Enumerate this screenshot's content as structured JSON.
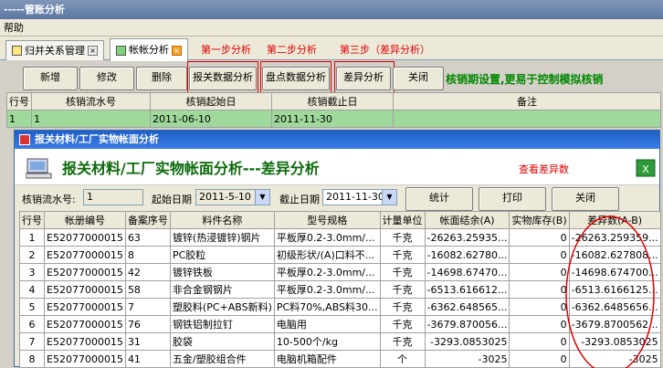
{
  "window": {
    "title": "-----管账分析"
  },
  "menu": {
    "help": "帮助"
  },
  "tabs": [
    {
      "label": "归并关系管理",
      "close": "×"
    },
    {
      "label": "帐帐分析",
      "close": "×"
    }
  ],
  "annotations": {
    "step1": "第一步分析",
    "step2": "第二步分析",
    "step3": "第三步（差异分析）",
    "check_diff": "查看差异数"
  },
  "toolbar": {
    "add": "新增",
    "edit": "修改",
    "delete": "删除",
    "customs_analysis": "报关数据分析",
    "inventory_analysis": "盘点数据分析",
    "diff_analysis": "差异分析",
    "close": "关闭",
    "hint": "核销期设置,更易于控制模拟核销"
  },
  "main_grid": {
    "headers": [
      "行号",
      "核销流水号",
      "核销起始日",
      "核销截止日",
      "备注"
    ],
    "rows": [
      [
        "1",
        "1",
        "2011-06-10",
        "2011-11-30",
        ""
      ]
    ]
  },
  "dialog": {
    "title": "报关材料/工厂实物帐面分析",
    "banner_title": "报关材料/工厂实物帐面分析---差异分析",
    "serial_label": "核销流水号:",
    "serial_value": "1",
    "start_label": "起始日期",
    "start_value": "2011-5-10",
    "end_label": "截止日期",
    "end_value": "2011-11-30",
    "stats_btn": "统计",
    "print_btn": "打印",
    "close_btn": "关闭",
    "grid": {
      "headers": [
        "行号",
        "帐册编号",
        "备案序号",
        "料件名称",
        "型号规格",
        "计量单位",
        "帐面结余(A)",
        "实物库存(B)",
        "差异数(A-B)"
      ],
      "rows": [
        [
          "1",
          "E52077000015",
          "63",
          "镀锌(热浸镀锌)钢片",
          "平板厚0.2-3.0mm/...",
          "千克",
          "-26263.25935...",
          "0",
          "-26263.259359..."
        ],
        [
          "2",
          "E52077000015",
          "8",
          "PC胶粒",
          "初级形状/(A)口料不...",
          "千克",
          "-16082.62780...",
          "0",
          "-16082.627808..."
        ],
        [
          "3",
          "E52077000015",
          "42",
          "镀锌铁板",
          "平板厚0.2-3.0mm/...",
          "千克",
          "-14698.67470...",
          "0",
          "-14698.674700..."
        ],
        [
          "4",
          "E52077000015",
          "58",
          "非合金钢钢片",
          "平板厚0.2-3.0mm/...",
          "千克",
          "-6513.616612...",
          "0",
          "-6513.6166125..."
        ],
        [
          "5",
          "E52077000015",
          "7",
          "塑胶料(PC+ABS新料)",
          "PC料70%,ABS料30...",
          "千克",
          "-6362.648565...",
          "0",
          "-6362.6485656..."
        ],
        [
          "6",
          "E52077000015",
          "76",
          "钢铁铝制拉钉",
          "电脑用",
          "千克",
          "-3679.870056...",
          "0",
          "-3679.8700562..."
        ],
        [
          "7",
          "E52077000015",
          "31",
          "胶袋",
          "10-500个/kg",
          "千克",
          "-3293.0853025",
          "0",
          "-3293.0853025"
        ],
        [
          "8",
          "E52077000015",
          "41",
          "五金/塑胶组合件",
          "电脑机箱配件",
          "个",
          "-3025",
          "0",
          "-3025"
        ]
      ]
    }
  },
  "colors": {
    "annotation": "#e00000",
    "hint": "#008800",
    "selected_row": "#9fd99b",
    "dialog_title": "#1f5fc8"
  }
}
